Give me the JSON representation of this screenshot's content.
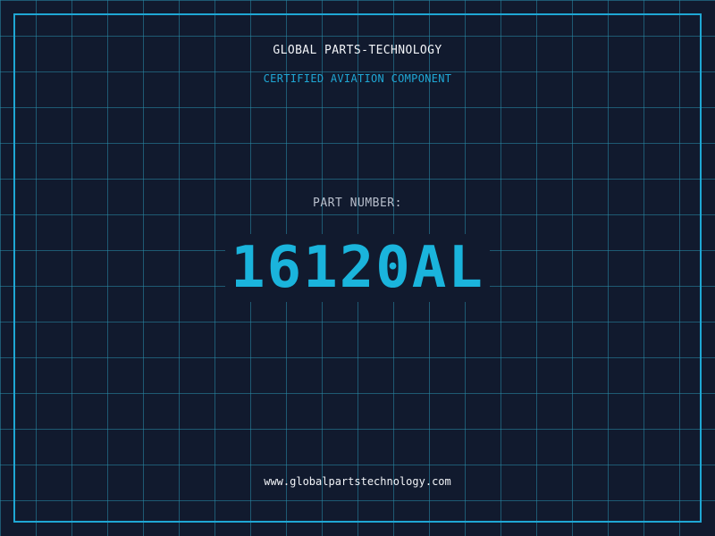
{
  "header": {
    "brand_name": "GLOBAL PARTS-TECHNOLOGY",
    "tagline": "CERTIFIED AVIATION COMPONENT"
  },
  "part": {
    "label": "PART NUMBER:",
    "number": "16120AL"
  },
  "footer": {
    "website": "www.globalpartstechnology.com"
  },
  "colors": {
    "background": "#111a2e",
    "grid": "#288caa",
    "accent": "#1fa7d4",
    "part_number": "#1ab4dc",
    "text_primary": "#f2f4f8",
    "text_muted": "#b8bfcc"
  }
}
